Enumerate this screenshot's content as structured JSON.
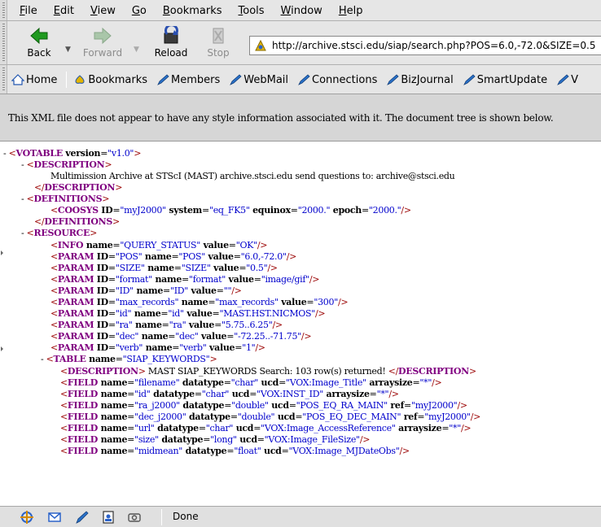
{
  "menubar": {
    "items": [
      "File",
      "Edit",
      "View",
      "Go",
      "Bookmarks",
      "Tools",
      "Window",
      "Help"
    ]
  },
  "navbar": {
    "back": "Back",
    "forward": "Forward",
    "reload": "Reload",
    "stop": "Stop",
    "url": "http://archive.stsci.edu/siap/search.php?POS=6.0,-72.0&SIZE=0.5"
  },
  "personalbar": {
    "items": [
      "Home",
      "Bookmarks",
      "Members",
      "WebMail",
      "Connections",
      "BizJournal",
      "SmartUpdate",
      "V"
    ]
  },
  "infobar": {
    "message": "This XML file does not appear to have any style information associated with it. The document tree is shown below."
  },
  "xml": [
    [
      {
        "k": "tg",
        "t": "<"
      },
      {
        "k": "tn",
        "t": "VOTABLE"
      },
      {
        "k": "an",
        "t": " version"
      },
      {
        "k": "txt",
        "t": "="
      },
      {
        "k": "av",
        "t": "\"v1.0\""
      },
      {
        "k": "tg",
        "t": ">"
      }
    ],
    [
      {
        "k": "tg",
        "t": "<"
      },
      {
        "k": "tn",
        "t": "DESCRIPTION"
      },
      {
        "k": "tg",
        "t": ">"
      }
    ],
    [
      {
        "k": "txt",
        "t": "Multimission Archive at STScI (MAST) archive.stsci.edu send questions to: archive@stsci.edu"
      }
    ],
    [
      {
        "k": "tg",
        "t": "</"
      },
      {
        "k": "tn",
        "t": "DESCRIPTION"
      },
      {
        "k": "tg",
        "t": ">"
      }
    ],
    [
      {
        "k": "tg",
        "t": "<"
      },
      {
        "k": "tn",
        "t": "DEFINITIONS"
      },
      {
        "k": "tg",
        "t": ">"
      }
    ],
    [
      {
        "k": "tg",
        "t": "<"
      },
      {
        "k": "tn",
        "t": "COOSYS"
      },
      {
        "k": "an",
        "t": " ID"
      },
      {
        "k": "txt",
        "t": "="
      },
      {
        "k": "av",
        "t": "\"myJ2000\""
      },
      {
        "k": "an",
        "t": " system"
      },
      {
        "k": "txt",
        "t": "="
      },
      {
        "k": "av",
        "t": "\"eq_FK5\""
      },
      {
        "k": "an",
        "t": " equinox"
      },
      {
        "k": "txt",
        "t": "="
      },
      {
        "k": "av",
        "t": "\"2000.\""
      },
      {
        "k": "an",
        "t": " epoch"
      },
      {
        "k": "txt",
        "t": "="
      },
      {
        "k": "av",
        "t": "\"2000.\""
      },
      {
        "k": "tg",
        "t": "/>"
      }
    ],
    [
      {
        "k": "tg",
        "t": "</"
      },
      {
        "k": "tn",
        "t": "DEFINITIONS"
      },
      {
        "k": "tg",
        "t": ">"
      }
    ],
    [
      {
        "k": "tg",
        "t": "<"
      },
      {
        "k": "tn",
        "t": "RESOURCE"
      },
      {
        "k": "tg",
        "t": ">"
      }
    ],
    [
      {
        "k": "tg",
        "t": "<"
      },
      {
        "k": "tn",
        "t": "INFO"
      },
      {
        "k": "an",
        "t": " name"
      },
      {
        "k": "txt",
        "t": "="
      },
      {
        "k": "av",
        "t": "\"QUERY_STATUS\""
      },
      {
        "k": "an",
        "t": " value"
      },
      {
        "k": "txt",
        "t": "="
      },
      {
        "k": "av",
        "t": "\"OK\""
      },
      {
        "k": "tg",
        "t": "/>"
      }
    ],
    [
      {
        "k": "tg",
        "t": "<"
      },
      {
        "k": "tn",
        "t": "PARAM"
      },
      {
        "k": "an",
        "t": " ID"
      },
      {
        "k": "txt",
        "t": "="
      },
      {
        "k": "av",
        "t": "\"POS\""
      },
      {
        "k": "an",
        "t": " name"
      },
      {
        "k": "txt",
        "t": "="
      },
      {
        "k": "av",
        "t": "\"POS\""
      },
      {
        "k": "an",
        "t": " value"
      },
      {
        "k": "txt",
        "t": "="
      },
      {
        "k": "av",
        "t": "\"6.0,-72.0\""
      },
      {
        "k": "tg",
        "t": "/>"
      }
    ],
    [
      {
        "k": "tg",
        "t": "<"
      },
      {
        "k": "tn",
        "t": "PARAM"
      },
      {
        "k": "an",
        "t": " ID"
      },
      {
        "k": "txt",
        "t": "="
      },
      {
        "k": "av",
        "t": "\"SIZE\""
      },
      {
        "k": "an",
        "t": " name"
      },
      {
        "k": "txt",
        "t": "="
      },
      {
        "k": "av",
        "t": "\"SIZE\""
      },
      {
        "k": "an",
        "t": " value"
      },
      {
        "k": "txt",
        "t": "="
      },
      {
        "k": "av",
        "t": "\"0.5\""
      },
      {
        "k": "tg",
        "t": "/>"
      }
    ],
    [
      {
        "k": "tg",
        "t": "<"
      },
      {
        "k": "tn",
        "t": "PARAM"
      },
      {
        "k": "an",
        "t": " ID"
      },
      {
        "k": "txt",
        "t": "="
      },
      {
        "k": "av",
        "t": "\"format\""
      },
      {
        "k": "an",
        "t": " name"
      },
      {
        "k": "txt",
        "t": "="
      },
      {
        "k": "av",
        "t": "\"format\""
      },
      {
        "k": "an",
        "t": " value"
      },
      {
        "k": "txt",
        "t": "="
      },
      {
        "k": "av",
        "t": "\"image/gif\""
      },
      {
        "k": "tg",
        "t": "/>"
      }
    ],
    [
      {
        "k": "tg",
        "t": "<"
      },
      {
        "k": "tn",
        "t": "PARAM"
      },
      {
        "k": "an",
        "t": " ID"
      },
      {
        "k": "txt",
        "t": "="
      },
      {
        "k": "av",
        "t": "\"ID\""
      },
      {
        "k": "an",
        "t": " name"
      },
      {
        "k": "txt",
        "t": "="
      },
      {
        "k": "av",
        "t": "\"ID\""
      },
      {
        "k": "an",
        "t": " value"
      },
      {
        "k": "txt",
        "t": "="
      },
      {
        "k": "av",
        "t": "\"\""
      },
      {
        "k": "tg",
        "t": "/>"
      }
    ],
    [
      {
        "k": "tg",
        "t": "<"
      },
      {
        "k": "tn",
        "t": "PARAM"
      },
      {
        "k": "an",
        "t": " ID"
      },
      {
        "k": "txt",
        "t": "="
      },
      {
        "k": "av",
        "t": "\"max_records\""
      },
      {
        "k": "an",
        "t": " name"
      },
      {
        "k": "txt",
        "t": "="
      },
      {
        "k": "av",
        "t": "\"max_records\""
      },
      {
        "k": "an",
        "t": " value"
      },
      {
        "k": "txt",
        "t": "="
      },
      {
        "k": "av",
        "t": "\"300\""
      },
      {
        "k": "tg",
        "t": "/>"
      }
    ],
    [
      {
        "k": "tg",
        "t": "<"
      },
      {
        "k": "tn",
        "t": "PARAM"
      },
      {
        "k": "an",
        "t": " ID"
      },
      {
        "k": "txt",
        "t": "="
      },
      {
        "k": "av",
        "t": "\"id\""
      },
      {
        "k": "an",
        "t": " name"
      },
      {
        "k": "txt",
        "t": "="
      },
      {
        "k": "av",
        "t": "\"id\""
      },
      {
        "k": "an",
        "t": " value"
      },
      {
        "k": "txt",
        "t": "="
      },
      {
        "k": "av",
        "t": "\"MAST.HST.NICMOS\""
      },
      {
        "k": "tg",
        "t": "/>"
      }
    ],
    [
      {
        "k": "tg",
        "t": "<"
      },
      {
        "k": "tn",
        "t": "PARAM"
      },
      {
        "k": "an",
        "t": " ID"
      },
      {
        "k": "txt",
        "t": "="
      },
      {
        "k": "av",
        "t": "\"ra\""
      },
      {
        "k": "an",
        "t": " name"
      },
      {
        "k": "txt",
        "t": "="
      },
      {
        "k": "av",
        "t": "\"ra\""
      },
      {
        "k": "an",
        "t": " value"
      },
      {
        "k": "txt",
        "t": "="
      },
      {
        "k": "av",
        "t": "\"5.75..6.25\""
      },
      {
        "k": "tg",
        "t": "/>"
      }
    ],
    [
      {
        "k": "tg",
        "t": "<"
      },
      {
        "k": "tn",
        "t": "PARAM"
      },
      {
        "k": "an",
        "t": " ID"
      },
      {
        "k": "txt",
        "t": "="
      },
      {
        "k": "av",
        "t": "\"dec\""
      },
      {
        "k": "an",
        "t": " name"
      },
      {
        "k": "txt",
        "t": "="
      },
      {
        "k": "av",
        "t": "\"dec\""
      },
      {
        "k": "an",
        "t": " value"
      },
      {
        "k": "txt",
        "t": "="
      },
      {
        "k": "av",
        "t": "\"-72.25..-71.75\""
      },
      {
        "k": "tg",
        "t": "/>"
      }
    ],
    [
      {
        "k": "tg",
        "t": "<"
      },
      {
        "k": "tn",
        "t": "PARAM"
      },
      {
        "k": "an",
        "t": " ID"
      },
      {
        "k": "txt",
        "t": "="
      },
      {
        "k": "av",
        "t": "\"verb\""
      },
      {
        "k": "an",
        "t": " name"
      },
      {
        "k": "txt",
        "t": "="
      },
      {
        "k": "av",
        "t": "\"verb\""
      },
      {
        "k": "an",
        "t": " value"
      },
      {
        "k": "txt",
        "t": "="
      },
      {
        "k": "av",
        "t": "\"1\""
      },
      {
        "k": "tg",
        "t": "/>"
      }
    ],
    [
      {
        "k": "tg",
        "t": "<"
      },
      {
        "k": "tn",
        "t": "TABLE"
      },
      {
        "k": "an",
        "t": " name"
      },
      {
        "k": "txt",
        "t": "="
      },
      {
        "k": "av",
        "t": "\"SIAP_KEYWORDS\""
      },
      {
        "k": "tg",
        "t": ">"
      }
    ],
    [
      {
        "k": "tg",
        "t": "<"
      },
      {
        "k": "tn",
        "t": "DESCRIPTION"
      },
      {
        "k": "tg",
        "t": ">"
      },
      {
        "k": "txt",
        "t": " MAST SIAP_KEYWORDS Search: 103 row(s) returned! "
      },
      {
        "k": "tg",
        "t": "</"
      },
      {
        "k": "tn",
        "t": "DESCRIPTION"
      },
      {
        "k": "tg",
        "t": ">"
      }
    ],
    [
      {
        "k": "tg",
        "t": "<"
      },
      {
        "k": "tn",
        "t": "FIELD"
      },
      {
        "k": "an",
        "t": " name"
      },
      {
        "k": "txt",
        "t": "="
      },
      {
        "k": "av",
        "t": "\"filename\""
      },
      {
        "k": "an",
        "t": " datatype"
      },
      {
        "k": "txt",
        "t": "="
      },
      {
        "k": "av",
        "t": "\"char\""
      },
      {
        "k": "an",
        "t": " ucd"
      },
      {
        "k": "txt",
        "t": "="
      },
      {
        "k": "av",
        "t": "\"VOX:Image_Title\""
      },
      {
        "k": "an",
        "t": " arraysize"
      },
      {
        "k": "txt",
        "t": "="
      },
      {
        "k": "av",
        "t": "\"*\""
      },
      {
        "k": "tg",
        "t": "/>"
      }
    ],
    [
      {
        "k": "tg",
        "t": "<"
      },
      {
        "k": "tn",
        "t": "FIELD"
      },
      {
        "k": "an",
        "t": " name"
      },
      {
        "k": "txt",
        "t": "="
      },
      {
        "k": "av",
        "t": "\"id\""
      },
      {
        "k": "an",
        "t": " datatype"
      },
      {
        "k": "txt",
        "t": "="
      },
      {
        "k": "av",
        "t": "\"char\""
      },
      {
        "k": "an",
        "t": " ucd"
      },
      {
        "k": "txt",
        "t": "="
      },
      {
        "k": "av",
        "t": "\"VOX:INST_ID\""
      },
      {
        "k": "an",
        "t": " arraysize"
      },
      {
        "k": "txt",
        "t": "="
      },
      {
        "k": "av",
        "t": "\"*\""
      },
      {
        "k": "tg",
        "t": "/>"
      }
    ],
    [
      {
        "k": "tg",
        "t": "<"
      },
      {
        "k": "tn",
        "t": "FIELD"
      },
      {
        "k": "an",
        "t": " name"
      },
      {
        "k": "txt",
        "t": "="
      },
      {
        "k": "av",
        "t": "\"ra_j2000\""
      },
      {
        "k": "an",
        "t": " datatype"
      },
      {
        "k": "txt",
        "t": "="
      },
      {
        "k": "av",
        "t": "\"double\""
      },
      {
        "k": "an",
        "t": " ucd"
      },
      {
        "k": "txt",
        "t": "="
      },
      {
        "k": "av",
        "t": "\"POS_EQ_RA_MAIN\""
      },
      {
        "k": "an",
        "t": " ref"
      },
      {
        "k": "txt",
        "t": "="
      },
      {
        "k": "av",
        "t": "\"myJ2000\""
      },
      {
        "k": "tg",
        "t": "/>"
      }
    ],
    [
      {
        "k": "tg",
        "t": "<"
      },
      {
        "k": "tn",
        "t": "FIELD"
      },
      {
        "k": "an",
        "t": " name"
      },
      {
        "k": "txt",
        "t": "="
      },
      {
        "k": "av",
        "t": "\"dec_j2000\""
      },
      {
        "k": "an",
        "t": " datatype"
      },
      {
        "k": "txt",
        "t": "="
      },
      {
        "k": "av",
        "t": "\"double\""
      },
      {
        "k": "an",
        "t": " ucd"
      },
      {
        "k": "txt",
        "t": "="
      },
      {
        "k": "av",
        "t": "\"POS_EQ_DEC_MAIN\""
      },
      {
        "k": "an",
        "t": " ref"
      },
      {
        "k": "txt",
        "t": "="
      },
      {
        "k": "av",
        "t": "\"myJ2000\""
      },
      {
        "k": "tg",
        "t": "/>"
      }
    ],
    [
      {
        "k": "tg",
        "t": "<"
      },
      {
        "k": "tn",
        "t": "FIELD"
      },
      {
        "k": "an",
        "t": " name"
      },
      {
        "k": "txt",
        "t": "="
      },
      {
        "k": "av",
        "t": "\"url\""
      },
      {
        "k": "an",
        "t": " datatype"
      },
      {
        "k": "txt",
        "t": "="
      },
      {
        "k": "av",
        "t": "\"char\""
      },
      {
        "k": "an",
        "t": " ucd"
      },
      {
        "k": "txt",
        "t": "="
      },
      {
        "k": "av",
        "t": "\"VOX:Image_AccessReference\""
      },
      {
        "k": "an",
        "t": " arraysize"
      },
      {
        "k": "txt",
        "t": "="
      },
      {
        "k": "av",
        "t": "\"*\""
      },
      {
        "k": "tg",
        "t": "/>"
      }
    ],
    [
      {
        "k": "tg",
        "t": "<"
      },
      {
        "k": "tn",
        "t": "FIELD"
      },
      {
        "k": "an",
        "t": " name"
      },
      {
        "k": "txt",
        "t": "="
      },
      {
        "k": "av",
        "t": "\"size\""
      },
      {
        "k": "an",
        "t": " datatype"
      },
      {
        "k": "txt",
        "t": "="
      },
      {
        "k": "av",
        "t": "\"long\""
      },
      {
        "k": "an",
        "t": " ucd"
      },
      {
        "k": "txt",
        "t": "="
      },
      {
        "k": "av",
        "t": "\"VOX:Image_FileSize\""
      },
      {
        "k": "tg",
        "t": "/>"
      }
    ],
    [
      {
        "k": "tg",
        "t": "<"
      },
      {
        "k": "tn",
        "t": "FIELD"
      },
      {
        "k": "an",
        "t": " name"
      },
      {
        "k": "txt",
        "t": "="
      },
      {
        "k": "av",
        "t": "\"midmean\""
      },
      {
        "k": "an",
        "t": " datatype"
      },
      {
        "k": "txt",
        "t": "="
      },
      {
        "k": "av",
        "t": "\"float\""
      },
      {
        "k": "an",
        "t": " ucd"
      },
      {
        "k": "txt",
        "t": "="
      },
      {
        "k": "av",
        "t": "\"VOX:Image_MJDateObs\""
      },
      {
        "k": "tg",
        "t": "/>"
      }
    ]
  ],
  "statusbar": {
    "status": "Done"
  }
}
